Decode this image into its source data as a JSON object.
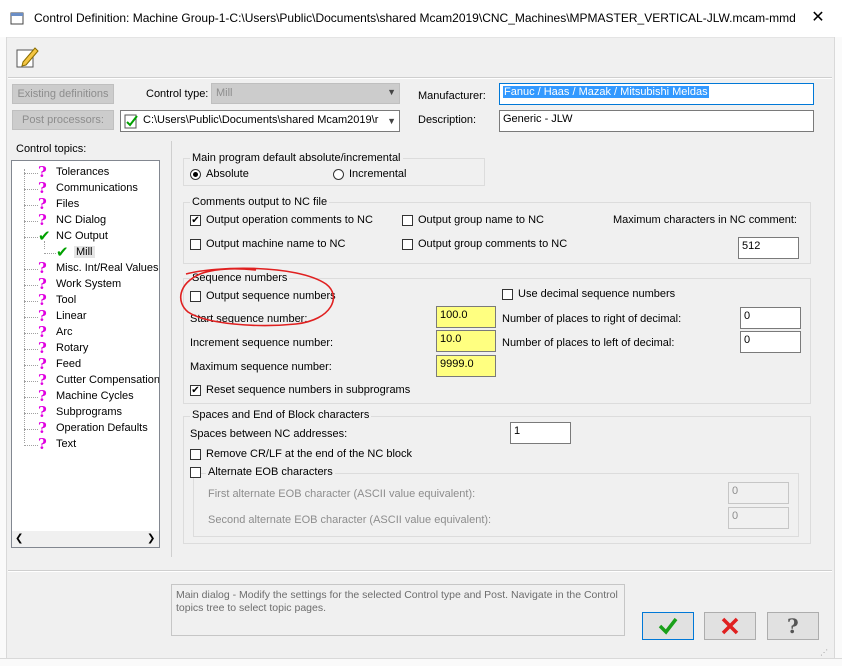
{
  "window": {
    "title": "Control Definition: Machine Group-1-C:\\Users\\Public\\Documents\\shared Mcam2019\\CNC_Machines\\MPMASTER_VERTICAL-JLW.mcam-mmd",
    "close": "✕"
  },
  "top": {
    "existing_definitions": "Existing definitions",
    "post_processors": "Post processors:",
    "control_type_label": "Control type:",
    "control_type_value": "Mill",
    "post_path": "C:\\Users\\Public\\Documents\\shared Mcam2019\\r",
    "manufacturer_label": "Manufacturer:",
    "manufacturer_value": "Fanuc / Haas / Mazak / Mitsubishi Meldas",
    "description_label": "Description:",
    "description_value": "Generic - JLW"
  },
  "tree": {
    "header": "Control topics:",
    "items": [
      {
        "label": "Tolerances",
        "icon": "question-icon"
      },
      {
        "label": "Communications",
        "icon": "question-icon"
      },
      {
        "label": "Files",
        "icon": "question-icon"
      },
      {
        "label": "NC Dialog",
        "icon": "question-icon"
      },
      {
        "label": "NC Output",
        "icon": "check-icon"
      },
      {
        "label": "Mill",
        "icon": "check-icon"
      },
      {
        "label": "Misc. Int/Real Values",
        "icon": "question-icon"
      },
      {
        "label": "Work System",
        "icon": "question-icon"
      },
      {
        "label": "Tool",
        "icon": "question-icon"
      },
      {
        "label": "Linear",
        "icon": "question-icon"
      },
      {
        "label": "Arc",
        "icon": "question-icon"
      },
      {
        "label": "Rotary",
        "icon": "question-icon"
      },
      {
        "label": "Feed",
        "icon": "question-icon"
      },
      {
        "label": "Cutter Compensation",
        "icon": "question-icon"
      },
      {
        "label": "Machine Cycles",
        "icon": "question-icon"
      },
      {
        "label": "Subprograms",
        "icon": "question-icon"
      },
      {
        "label": "Operation Defaults",
        "icon": "question-icon"
      },
      {
        "label": "Text",
        "icon": "question-icon"
      }
    ]
  },
  "main_program": {
    "title": "Main program default absolute/incremental",
    "absolute": "Absolute",
    "incremental": "Incremental",
    "selected": "Absolute"
  },
  "comments": {
    "title": "Comments output to NC file",
    "op_comments": "Output operation comments to NC",
    "op_comments_checked": true,
    "group_name": "Output group name to NC",
    "group_name_checked": false,
    "machine_name": "Output machine name to NC",
    "machine_name_checked": false,
    "group_comments": "Output group comments to NC",
    "group_comments_checked": false,
    "max_chars_label": "Maximum characters in NC comment:",
    "max_chars_value": "512"
  },
  "sequence": {
    "title": "Sequence numbers",
    "output_seq": "Output sequence numbers",
    "output_seq_checked": false,
    "use_decimal": "Use decimal sequence numbers",
    "use_decimal_checked": false,
    "start_label": "Start sequence number:",
    "start_value": "100.0",
    "increment_label": "Increment sequence number:",
    "increment_value": "10.0",
    "max_label": "Maximum sequence number:",
    "max_value": "9999.0",
    "right_label": "Number of places to right of decimal:",
    "right_value": "0",
    "left_label": "Number of places to left of decimal:",
    "left_value": "0",
    "reset_label": "Reset sequence numbers in subprograms",
    "reset_checked": true
  },
  "eob": {
    "title": "Spaces and End of Block characters",
    "spaces_label": "Spaces between NC addresses:",
    "spaces_value": "1",
    "remove_crlf": "Remove CR/LF at the end of the NC block",
    "remove_crlf_checked": false,
    "alt_eob": "Alternate EOB characters",
    "alt_eob_checked": false,
    "first_label": "First alternate EOB character (ASCII value equivalent):",
    "first_value": "0",
    "second_label": "Second alternate EOB character (ASCII value equivalent):",
    "second_value": "0"
  },
  "status": {
    "text": "Main dialog - Modify the settings for the selected Control type and Post.  Navigate in the Control topics tree to select topic pages."
  },
  "colors": {
    "highlight": "#3399ff",
    "required_field": "#ffff80",
    "annotation_red": "#e02020",
    "question_icon": "#e000e0",
    "check_icon": "#00a000"
  }
}
